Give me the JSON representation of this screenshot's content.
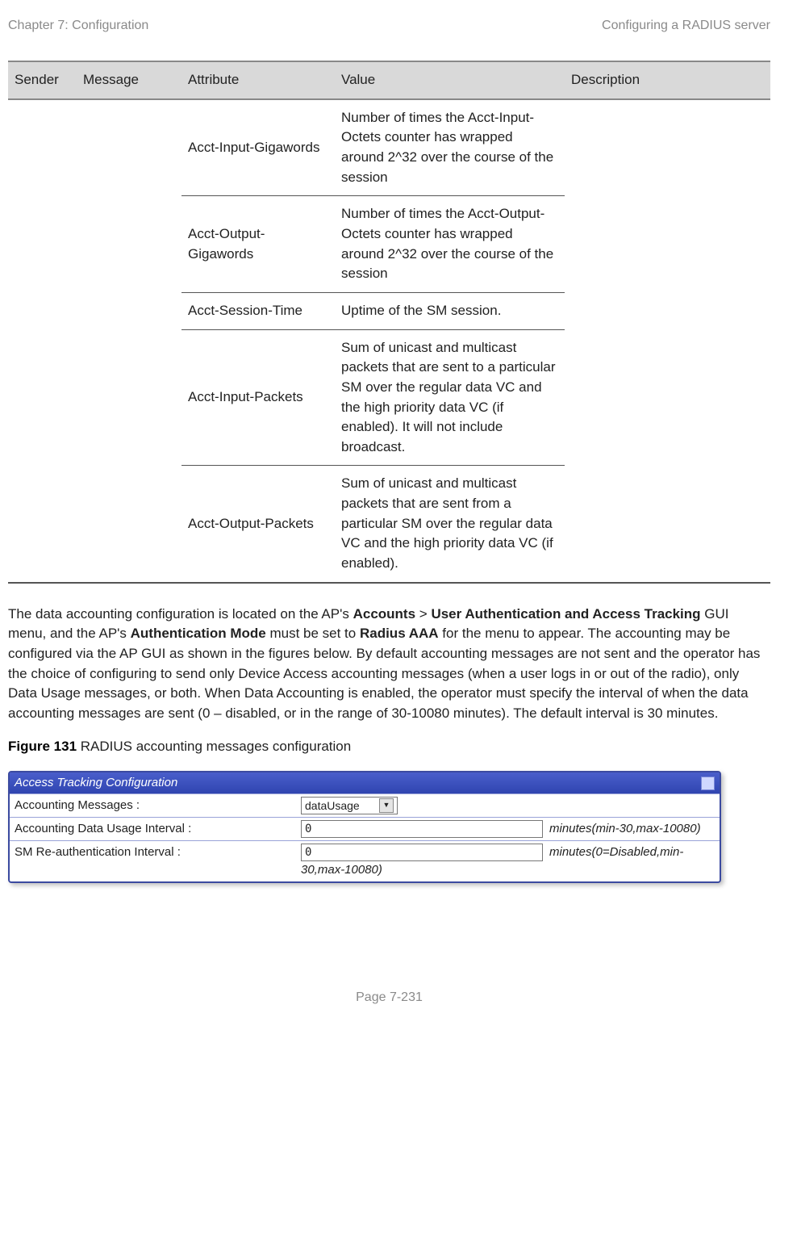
{
  "header": {
    "left": "Chapter 7:  Configuration",
    "right": "Configuring a RADIUS server"
  },
  "table": {
    "headers": {
      "sender": "Sender",
      "message": "Message",
      "attribute": "Attribute",
      "value": "Value",
      "description": "Description"
    },
    "rows": [
      {
        "attribute": "Acct-Input-Gigawords",
        "value": "Number of times the Acct-Input-Octets counter has wrapped around 2^32 over the course of the session"
      },
      {
        "attribute": "Acct-Output-Gigawords",
        "value": "Number of times the Acct-Output-Octets counter has wrapped around 2^32 over the course of the session"
      },
      {
        "attribute": "Acct-Session-Time",
        "value": "Uptime of the SM session."
      },
      {
        "attribute": "Acct-Input-Packets",
        "value": "Sum of unicast and multicast packets that are sent to a particular SM over the regular data VC and the high priority data VC (if enabled). It will not include broadcast."
      },
      {
        "attribute": "Acct-Output-Packets",
        "value": "Sum of unicast and multicast packets that are sent from a particular SM over the regular data VC and the high priority data VC (if enabled)."
      }
    ]
  },
  "paragraph": {
    "pre1": "The data accounting configuration is located on the AP's ",
    "b1": "Accounts",
    "gt": " > ",
    "b2": "User Authentication and Access Tracking",
    "mid1": " GUI menu, and the AP's ",
    "b3": "Authentication Mode",
    "mid2": " must be set to ",
    "b4": "Radius AAA",
    "tail": " for the menu to appear. The accounting may be configured via the AP GUI as shown in the figures below. By default accounting messages are not sent and the operator has the choice of configuring to send only Device Access accounting messages (when a user logs in or out of the radio), only Data Usage messages, or both. When Data Accounting is enabled, the operator must specify the interval of when the data accounting messages are sent (0 – disabled, or in the range of 30-10080 minutes). The default interval is 30 minutes."
  },
  "figure": {
    "label_prefix": "Figure 131",
    "label_rest": " RADIUS accounting messages configuration",
    "panel_title": "Access Tracking Configuration",
    "rows": {
      "r1_label": "Accounting Messages :",
      "r1_value": "dataUsage",
      "r2_label": "Accounting Data Usage Interval :",
      "r2_value": "0",
      "r2_hint": "minutes(min-30,max-10080)",
      "r3_label": "SM Re-authentication Interval :",
      "r3_value": "0",
      "r3_hint_a": "minutes(0=Disabled,min-",
      "r3_hint_b": "30,max-10080)"
    }
  },
  "footer": "Page 7-231"
}
